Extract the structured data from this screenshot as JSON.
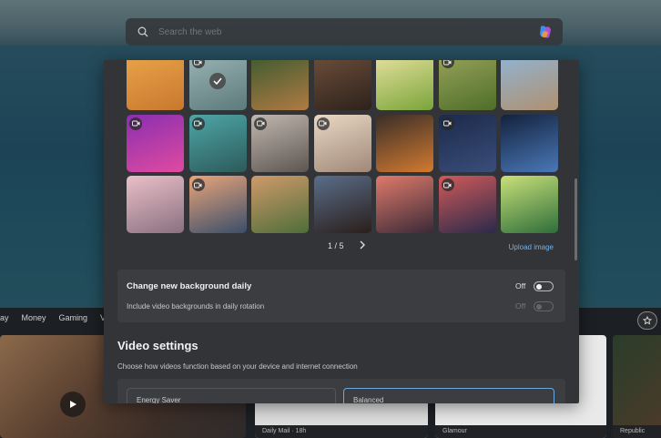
{
  "search": {
    "placeholder": "Search the web",
    "icon": "search-icon",
    "assistant_icon": "copilot-icon"
  },
  "nav": {
    "items": [
      "ay",
      "Money",
      "Gaming",
      "V"
    ],
    "right_icon": "pin-icon"
  },
  "feed": {
    "card_a_footer": "",
    "card_b_footer": "Daily Mail · 18h",
    "card_c_footer": "Glamour",
    "card_d_footer": "Republic"
  },
  "gallery": {
    "thumbnails": [
      {
        "name": "desert-oryx",
        "video": false,
        "selected": false,
        "colors": [
          "#e9a54a",
          "#c9782e"
        ]
      },
      {
        "name": "misty-cliffs",
        "video": true,
        "selected": true,
        "colors": [
          "#9bb5b5",
          "#5d7a7c"
        ]
      },
      {
        "name": "jungle-waterfall",
        "video": false,
        "selected": false,
        "colors": [
          "#3a5a2f",
          "#b07a43"
        ]
      },
      {
        "name": "sand-dunes",
        "video": false,
        "selected": false,
        "colors": [
          "#6e4f3b",
          "#2d221c"
        ]
      },
      {
        "name": "green-hills",
        "video": false,
        "selected": false,
        "colors": [
          "#e9e3a0",
          "#7aa43a"
        ]
      },
      {
        "name": "hill-fields",
        "video": true,
        "selected": false,
        "colors": [
          "#9aa45a",
          "#4e6e2a"
        ]
      },
      {
        "name": "coastal-town",
        "video": false,
        "selected": false,
        "colors": [
          "#8fb5d5",
          "#b09070"
        ]
      },
      {
        "name": "purple-abstract",
        "video": true,
        "selected": false,
        "colors": [
          "#8a2fb0",
          "#e04aa0"
        ]
      },
      {
        "name": "teal-lagoon",
        "video": true,
        "selected": false,
        "colors": [
          "#4ea6a8",
          "#2d5a5a"
        ]
      },
      {
        "name": "foggy-peaks",
        "video": true,
        "selected": false,
        "colors": [
          "#c0b8b0",
          "#5d5550"
        ]
      },
      {
        "name": "white-dunes",
        "video": true,
        "selected": false,
        "colors": [
          "#e9d8c4",
          "#a08878"
        ]
      },
      {
        "name": "orange-dunes",
        "video": false,
        "selected": false,
        "colors": [
          "#3a2e28",
          "#d27a30"
        ]
      },
      {
        "name": "night-sky",
        "video": true,
        "selected": false,
        "colors": [
          "#1c2a4a",
          "#3a4e7a"
        ]
      },
      {
        "name": "milky-way-lake",
        "video": false,
        "selected": false,
        "colors": [
          "#13223d",
          "#4a78b8"
        ]
      },
      {
        "name": "pink-stones",
        "video": false,
        "selected": false,
        "colors": [
          "#e9c0c8",
          "#8a7080"
        ]
      },
      {
        "name": "sunset-bay",
        "video": true,
        "selected": false,
        "colors": [
          "#e9a57a",
          "#3a4e6a"
        ]
      },
      {
        "name": "rice-terraces",
        "video": false,
        "selected": false,
        "colors": [
          "#d09a6a",
          "#4e6e3a"
        ]
      },
      {
        "name": "starry-rocks",
        "video": false,
        "selected": false,
        "colors": [
          "#5a6e8a",
          "#2a1e1a"
        ]
      },
      {
        "name": "red-lake",
        "video": false,
        "selected": false,
        "colors": [
          "#e07a6a",
          "#3a2a38"
        ]
      },
      {
        "name": "lantern-village",
        "video": true,
        "selected": false,
        "colors": [
          "#d05a5a",
          "#2a2a4a"
        ]
      },
      {
        "name": "green-terraces",
        "video": false,
        "selected": false,
        "colors": [
          "#c9e07a",
          "#2e6e3a"
        ]
      }
    ],
    "page_current": "1",
    "page_total": "5",
    "page_label": "1 / 5",
    "upload_label": "Upload image"
  },
  "daily": {
    "title": "Change new background daily",
    "title_state": "Off",
    "title_on": false,
    "sub": "Include video backgrounds in daily rotation",
    "sub_state": "Off",
    "sub_on": false
  },
  "video_settings": {
    "title": "Video settings",
    "description": "Choose how videos function based on your device and internet connection",
    "option_a": "Energy Saver",
    "option_b": "Balanced"
  }
}
